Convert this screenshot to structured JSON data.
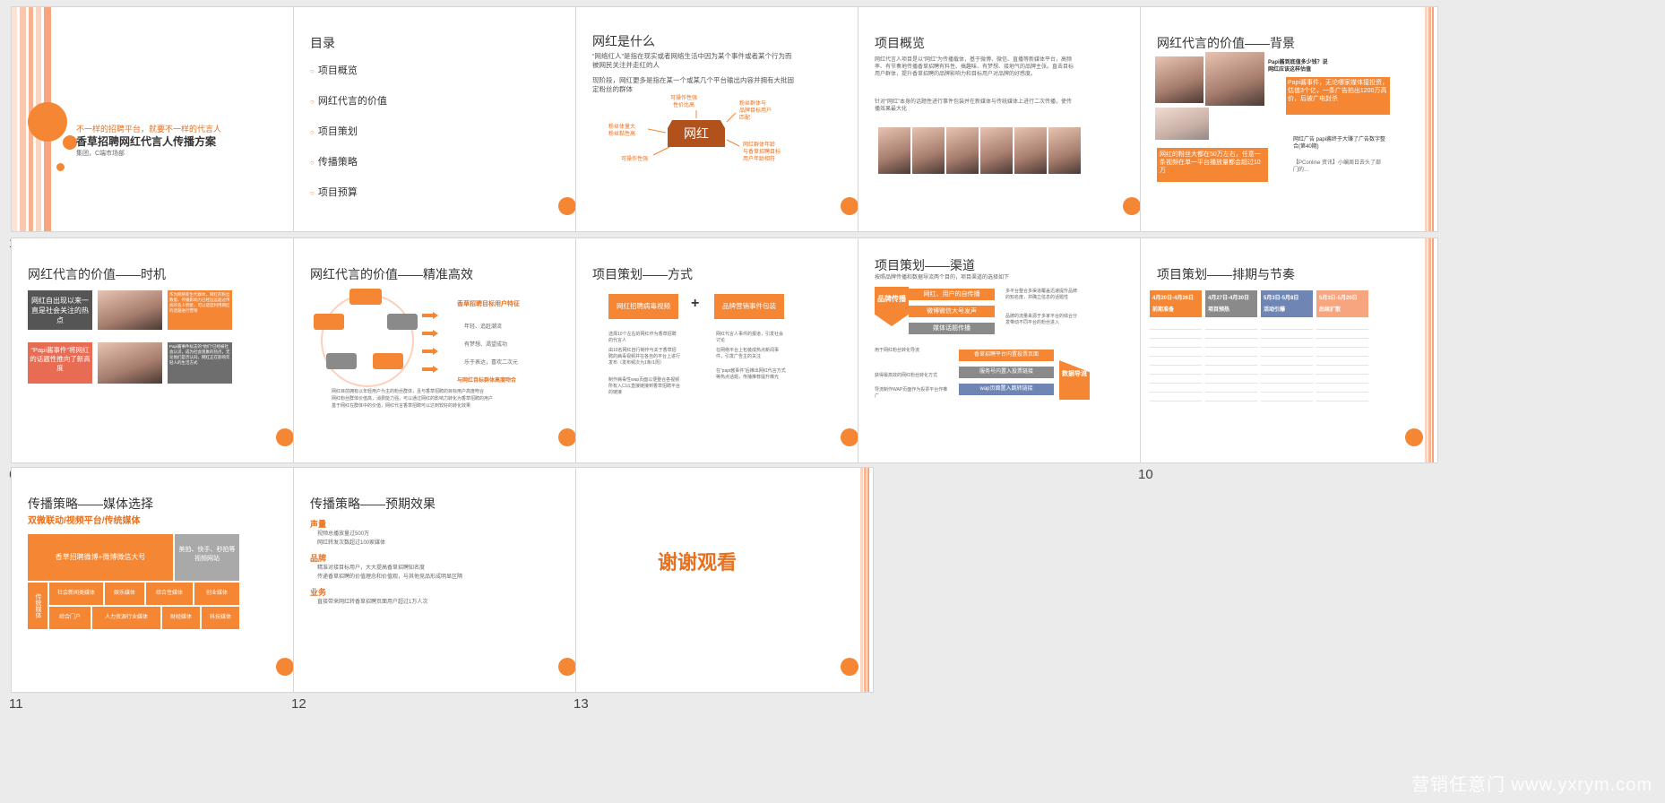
{
  "slides": [
    {
      "n": "1",
      "tagline": "不一样的招聘平台，就要不一样的代言人",
      "title": "香草招聘网红代言人传播方案",
      "author": "集团，C端市场部"
    },
    {
      "n": "2",
      "title": "目录",
      "items": [
        "项目概览",
        "网红代言的价值",
        "项目策划",
        "传播策略",
        "项目预算"
      ]
    },
    {
      "n": "3",
      "title": "网红是什么",
      "p1": "“网络红人”是指在现实或者网络生活中因为某个事件或者某个行为而被网民关注并走红的人",
      "p2": "现阶段，网红更多是指在某一个或某几个平台输出内容并拥有大批固定粉丝的群体",
      "center": "网红",
      "n1": "可操作性强\n性价比高",
      "n2": "粉丝群体与\n品牌目标用户\n匹配",
      "n3": "粉丝体量大\n粉丝黏性高",
      "n4": "可操作性强",
      "n5": "网红群体年龄\n与香草招聘目标\n用户年龄相符"
    },
    {
      "n": "4",
      "title": "项目概览",
      "p1": "网红代言人项目是以“网红”为传播载体，基于微博、微信、直播等新媒体平台，高频率、有节奏地传播香草招聘有料性、搞趣味、有梦想、接地气的品牌主张。直击目标用户群体，提升香草招聘的品牌影响力和目标用户对品牌的好感度。",
      "p2": "针对“网红”本身的话题性进行事件包装并在新媒体与传统媒体上进行二次传播，使传播效果最大化"
    },
    {
      "n": "5",
      "title": "网红代言的价值——背景",
      "h1": "Papi酱到底值多少钱？说网红应该这样估值",
      "c1": "Papi酱事件，无论哪家媒体接投资，估值3个亿，一条广告拍出1200万高价，后被广电封杀",
      "c2": "网红的粉丝大都在50万左右，任意一条视频在单一平台播放量都会超过10万",
      "h2": "网红广告 papi酱终于大赚了广告数字整合(第40期)",
      "h3": "【PConline 资讯】小编周日去头了部门的…"
    },
    {
      "n": "6",
      "title": "网红代言的价值——时机",
      "b1": "网红自出现以来一直是社会关注的热点",
      "b2": "“Papi酱事件”将网红的话题性推向了新高度",
      "t1": "作为网络新生代群体，网红的粉丝数量、传播影响力已经远远超过传统的名人明星，可以适度利用网红的话题进行营销",
      "t2": "Papi酱事件标志的“他们”已经被社会认识，成为社会现象的热点，无论他们是否认同，网红正在影响年轻人的生活方式"
    },
    {
      "n": "7",
      "title": "网红代言的价值——精准高效",
      "right_title": "香草招聘目标用户特征",
      "items": [
        "年轻、追赶潮流",
        "有梦想、渴望成功",
        "乐于表达，喜欢二次元"
      ],
      "right_foot": "与网红目标群体高度吻合",
      "bul": [
        "网红目前拥有以年轻用户为主的粉丝群体，且与香草招聘的目标用户高度吻合",
        "网红粉丝群体价值高，消费能力强，可以通过网红的影响力转化为香草招聘的用户",
        "基于网红在群体中的价值，网红代言香草招聘可以达到较好的转化效果"
      ]
    },
    {
      "n": "8",
      "title": "项目策划——方式",
      "left": "网红招聘病毒视频",
      "right": "品牌营销事件包装",
      "plus": "+",
      "l": [
        "选择10个左右的网红作为香草招聘的代言人",
        "由10名网红自行制作与关于香草招聘的病毒视频并在各自的平台上进行发布（发布频次为1条/1周）",
        "制作病毒性wap页面以便整合各视频所有入口以直接链接到香草招聘平台的链接"
      ],
      "r": [
        "网红代言人事件的报道，引发社会讨论",
        "在网络平台上包装成热点新闻事件，引发广告主的关注",
        "在“papi酱事件”后推出网红代言方式等热点话题，传播推荐提升曝光"
      ]
    },
    {
      "n": "9",
      "title": "项目策划——渠道",
      "sub": "按照品牌传播和数据导流两个目的，项目渠道的选择如下",
      "tag1": "品牌传播",
      "tag2": "数据导流",
      "g1": "网红、用户的自传播",
      "g2": "微博微信大号发声",
      "g3": "媒体话题传播",
      "d1": "香草招聘平台内置投票页面",
      "d2": "服务号内置入投票链接",
      "d3": "wap页面置入跳转链接",
      "r1": "多平台整合多渠道覆盖迅速提升品牌的知名度，并确立信息的话题性",
      "r2": "品牌的流量来源于多家平台的综合分发带动不同平台的粉丝进入",
      "b1": "用于网红粉丝转化导流",
      "b2": "获得最高效的网红粉丝转化方式",
      "b3": "导流制作WAP页面作为投票平台作推广"
    },
    {
      "n": "10",
      "title": "项目策划——排期与节奏",
      "cols": [
        {
          "h": "4月20日-4月26日",
          "s": "前期准备"
        },
        {
          "h": "4月27日-4月30日",
          "s": "项目预热"
        },
        {
          "h": "5月3日-5月8日",
          "s": "活动引爆"
        },
        {
          "h": "5月3日-5月20日",
          "s": "后续扩散"
        }
      ]
    },
    {
      "n": "11",
      "title": "传播策略——媒体选择",
      "sub": "双微联动/视频平台/传统媒体",
      "big": "香草招聘微博+微博微信大号",
      "grey": "美拍、快手、秒拍等视频网站",
      "v": "传统媒体",
      "cells": [
        "社会新闻类媒体",
        "娱乐媒体",
        "综合性媒体",
        "创业媒体",
        "综合门户",
        "人力资源行业媒体",
        "财经媒体",
        "科技媒体"
      ]
    },
    {
      "n": "12",
      "title": "传播策略——预期效果",
      "h1": "声量",
      "l1": [
        "视频总播放量过500万",
        "网红转发次数超过100家媒体"
      ],
      "h2": "品牌",
      "l2": [
        "精准对接目标用户，大大提高香草招聘知名度",
        "传递香草招聘的价值理念和价值观，与其他竞品形成明显区隔"
      ],
      "h3": "业务",
      "l3": [
        "直接带来网红转香草招聘页面用户超过1万人次"
      ]
    },
    {
      "n": "13",
      "text": "谢谢观看"
    }
  ],
  "watermark": "营销任意门 www.yxrym.com",
  "colors": {
    "accent": "#f58634",
    "grey": "#8a8a8a",
    "bg": "#ebebeb"
  }
}
